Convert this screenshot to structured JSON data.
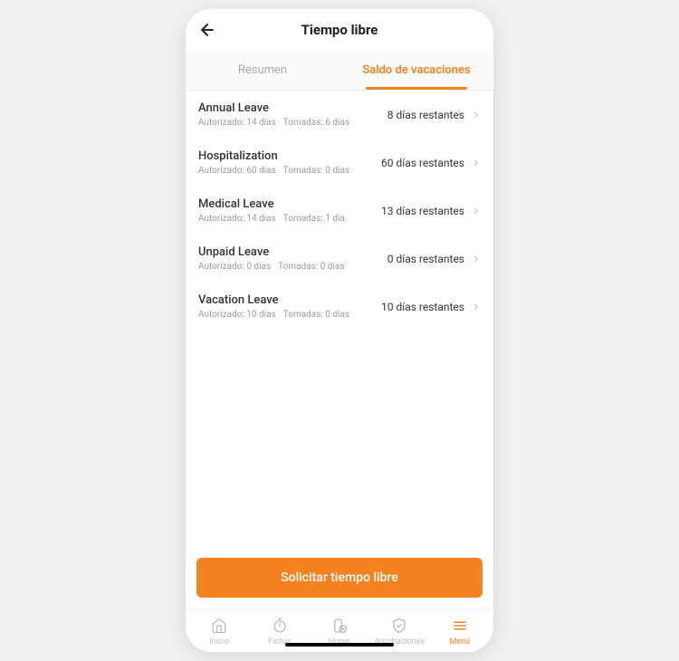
{
  "header": {
    "title": "Tiempo libre"
  },
  "tabs": {
    "summary": "Resumen",
    "balance": "Saldo de vacaciones"
  },
  "leaves": [
    {
      "name": "Annual Leave",
      "authorized_label": "Autorizado: 14 días",
      "taken_label": "Tomadas: 6 días",
      "remaining": "8 días restantes"
    },
    {
      "name": "Hospitalization",
      "authorized_label": "Autorizado: 60 días",
      "taken_label": "Tomadas: 0 días",
      "remaining": "60 días restantes"
    },
    {
      "name": "Medical Leave",
      "authorized_label": "Autorizado: 14 días",
      "taken_label": "Tomadas: 1 día",
      "remaining": "13 días restantes"
    },
    {
      "name": "Unpaid Leave",
      "authorized_label": "Autorizado: 0 días",
      "taken_label": "Tomadas: 0 días",
      "remaining": "0 días restantes"
    },
    {
      "name": "Vacation Leave",
      "authorized_label": "Autorizado: 10 días",
      "taken_label": "Tomadas: 0 días",
      "remaining": "10 días restantes"
    }
  ],
  "button": {
    "request": "Solicitar tiempo libre"
  },
  "nav": {
    "home": "Inicio",
    "clock": "Fichar",
    "hours": "Horas",
    "approvals": "Aprobaciones",
    "menu": "Menú"
  }
}
